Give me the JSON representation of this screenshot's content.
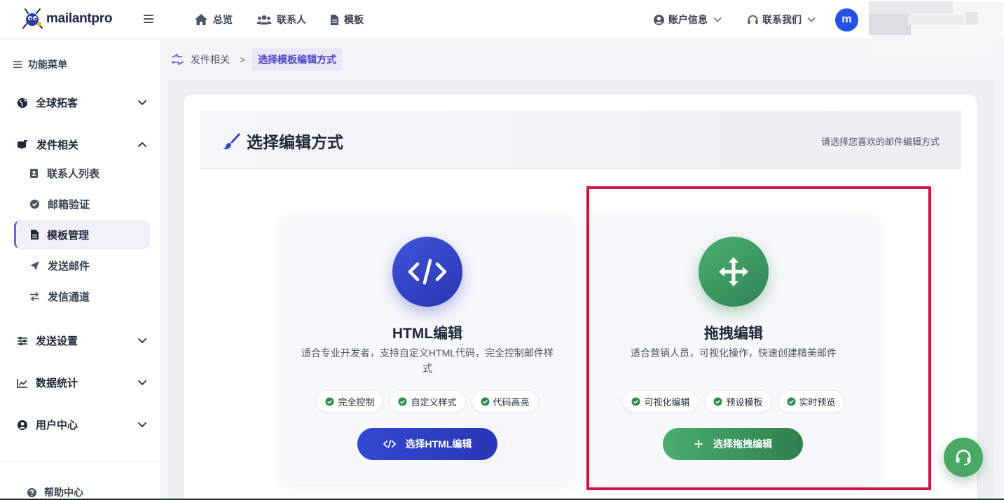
{
  "brand": {
    "name": "mailantpro"
  },
  "topnav": [
    {
      "label": "总览",
      "icon": "home-icon"
    },
    {
      "label": "联系人",
      "icon": "users-icon"
    },
    {
      "label": "模板",
      "icon": "file-icon"
    }
  ],
  "topright": {
    "account_label": "账户信息",
    "contact_label": "联系我们",
    "avatar_letter": "m"
  },
  "sidebar": {
    "title": "功能菜单",
    "groups": [
      {
        "label": "全球拓客",
        "icon": "globe-icon",
        "expanded": false
      },
      {
        "label": "发件相关",
        "icon": "mailbox-icon",
        "expanded": true
      },
      {
        "label": "发送设置",
        "icon": "sliders-icon",
        "expanded": false
      },
      {
        "label": "数据统计",
        "icon": "chart-line-icon",
        "expanded": false
      },
      {
        "label": "用户中心",
        "icon": "user-circle-icon",
        "expanded": false
      }
    ],
    "subitems": [
      {
        "label": "联系人列表",
        "icon": "contact-book-icon"
      },
      {
        "label": "邮箱验证",
        "icon": "check-circle-icon"
      },
      {
        "label": "模板管理",
        "icon": "file-icon",
        "active": true
      },
      {
        "label": "发送邮件",
        "icon": "paper-plane-icon"
      },
      {
        "label": "发信通道",
        "icon": "arrows-exchange-icon"
      }
    ],
    "help_label": "帮助中心"
  },
  "breadcrumb": {
    "parent": "发件相关",
    "separator": ">",
    "current": "选择模板编辑方式"
  },
  "header": {
    "title": "选择编辑方式",
    "subtitle": "请选择您喜欢的邮件编辑方式"
  },
  "options": {
    "html": {
      "title": "HTML编辑",
      "description": "适合专业开发者，支持自定义HTML代码，完全控制邮件样式",
      "features": [
        "完全控制",
        "自定义样式",
        "代码高亮"
      ],
      "button_label": "选择HTML编辑"
    },
    "drag": {
      "title": "拖拽编辑",
      "description": "适合营销人员，可视化操作，快速创建精美邮件",
      "features": [
        "可视化编辑",
        "预设模板",
        "实时预览"
      ],
      "button_label": "选择拖拽编辑"
    }
  },
  "colors": {
    "accent_blue": "#2f3cc4",
    "accent_green": "#3b9a60",
    "highlight_red": "#d0133f",
    "active_purple": "#6b63d6"
  }
}
